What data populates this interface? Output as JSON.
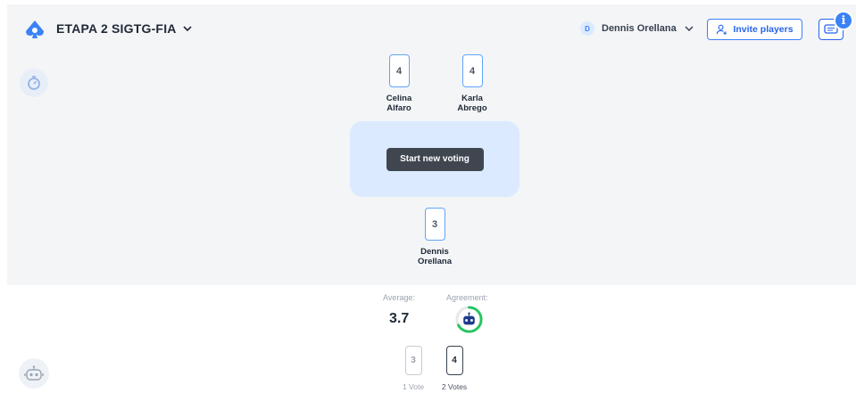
{
  "header": {
    "game_title": "ETAPA 2 SIGTG-FIA",
    "user_initial": "D",
    "user_name": "Dennis Orellana",
    "invite_label": "Invite players",
    "info_glyph": "i"
  },
  "icons": {
    "logo": "spade-logo-icon",
    "timer": "stopwatch-icon",
    "chat": "chat-icon",
    "info": "info-icon",
    "robot": "robot-icon",
    "invite": "user-plus-icon"
  },
  "colors": {
    "accent": "#3b82f6",
    "table": "#dbeafe",
    "button_dark": "#3f464f",
    "agreement": "#22c55e"
  },
  "players": [
    {
      "card": "4",
      "name_line1": "Celina",
      "name_line2": "Alfaro"
    },
    {
      "card": "4",
      "name_line1": "Karla",
      "name_line2": "Abrego"
    },
    {
      "card": "3",
      "name_line1": "Dennis",
      "name_line2": "Orellana"
    }
  ],
  "table": {
    "start_label": "Start new voting"
  },
  "results": {
    "average_label": "Average:",
    "average_value": "3.7",
    "agreement_label": "Agreement:",
    "agreement_level": 0.67,
    "votes": [
      {
        "card": "3",
        "count_label": "1 Vote"
      },
      {
        "card": "4",
        "count_label": "2 Votes"
      }
    ]
  }
}
